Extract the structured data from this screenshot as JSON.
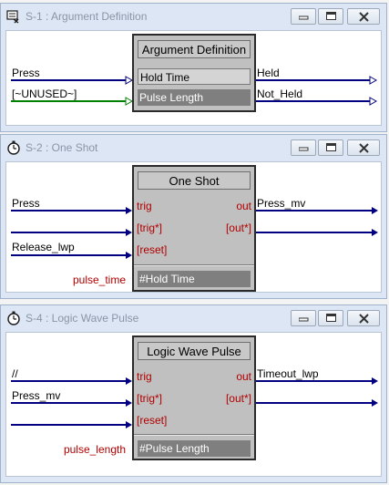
{
  "windows": [
    {
      "title": "S-1 : Argument Definition",
      "icon": "definition-icon",
      "block": {
        "title": "Argument Definition",
        "params": [
          "Hold Time",
          "Pulse Length"
        ]
      },
      "inputs": [
        "Press",
        "[~UNUSED~]"
      ],
      "outputs": [
        "Held",
        "Not_Held"
      ]
    },
    {
      "title": "S-2 : One Shot",
      "icon": "stopwatch-icon",
      "block": {
        "title": "One Shot",
        "in_ports": [
          "trig",
          "[trig*]",
          "[reset]"
        ],
        "out_ports": [
          "out",
          "[out*]"
        ],
        "param_value": "#Hold Time"
      },
      "inputs": [
        "Press",
        "",
        "Release_lwp"
      ],
      "outputs": [
        "Press_mv",
        ""
      ],
      "param_label": "pulse_time"
    },
    {
      "title": "S-4 : Logic Wave Pulse",
      "icon": "stopwatch-icon",
      "block": {
        "title": "Logic Wave Pulse",
        "in_ports": [
          "trig",
          "[trig*]",
          "[reset]"
        ],
        "out_ports": [
          "out",
          "[out*]"
        ],
        "param_value": "#Pulse Length"
      },
      "inputs": [
        "//",
        "Press_mv",
        ""
      ],
      "outputs": [
        "Timeout_lwp",
        ""
      ],
      "param_label": "pulse_length"
    }
  ],
  "colors": {
    "wire_blue": "#000080",
    "wire_green": "#008000",
    "port_red": "#b00000",
    "window_frame": "#dce6f4"
  }
}
